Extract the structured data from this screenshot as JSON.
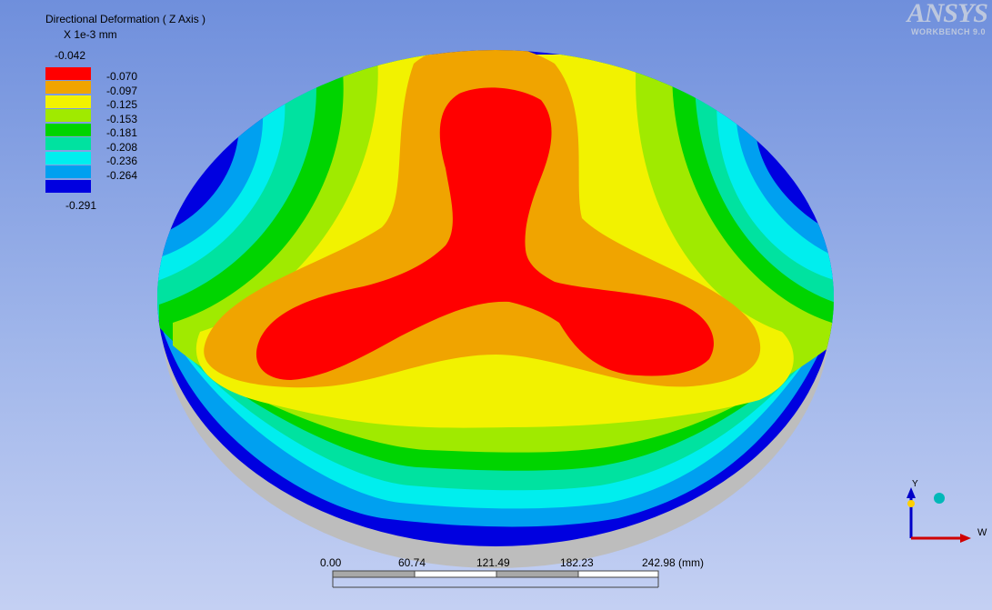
{
  "result": {
    "title": "Directional Deformation ( Z Axis )",
    "units": "X 1e-3 mm"
  },
  "legend": {
    "max": "-0.042",
    "min": "-0.291",
    "bands": [
      {
        "color": "#ff0000",
        "label": "-0.070"
      },
      {
        "color": "#f0a400",
        "label": "-0.097"
      },
      {
        "color": "#f2f200",
        "label": "-0.125"
      },
      {
        "color": "#a0ea00",
        "label": "-0.153"
      },
      {
        "color": "#00d400",
        "label": "-0.181"
      },
      {
        "color": "#00e2a0",
        "label": "-0.208"
      },
      {
        "color": "#00eeee",
        "label": "-0.236"
      },
      {
        "color": "#00a0f0",
        "label": "-0.264"
      },
      {
        "color": "#0000e0",
        "label": ""
      }
    ]
  },
  "logo": {
    "brand": "ANSYS",
    "product": "WORKBENCH 9.0"
  },
  "scale_bar": {
    "ticks": [
      "0.00",
      "60.74",
      "121.49",
      "182.23",
      "242.98 (mm)"
    ]
  },
  "triad": {
    "axis_y_label": "Y",
    "axis_x_label": "W"
  },
  "colors": {
    "background_top": "#6f8fdc",
    "background_bottom": "#c4d0f3",
    "plate_side": "#d2d2d2"
  }
}
